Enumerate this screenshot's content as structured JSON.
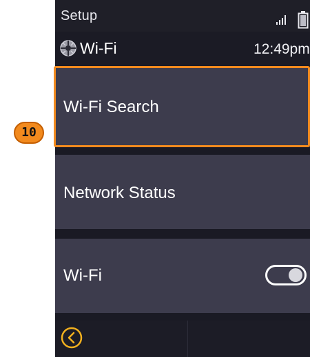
{
  "header": {
    "breadcrumb": "Setup",
    "title": "Wi-Fi",
    "title_icon": "wifi-globe-icon",
    "clock": "12:49pm",
    "status_icons": [
      "signal-bars-icon",
      "battery-icon"
    ]
  },
  "menu": {
    "items": [
      {
        "label": "Wi-Fi Search",
        "selected": true
      },
      {
        "label": "Network Status"
      },
      {
        "label": "Wi-Fi",
        "toggle": true,
        "toggle_state": "on"
      }
    ]
  },
  "footer": {
    "back_icon": "back-chevron-icon"
  },
  "annotation": {
    "step_badge": "10",
    "highlight_color": "#f28a1e"
  },
  "colors": {
    "background": "#1a1a24",
    "menu_item": "#3d3c4d",
    "accent": "#f28a1e"
  }
}
